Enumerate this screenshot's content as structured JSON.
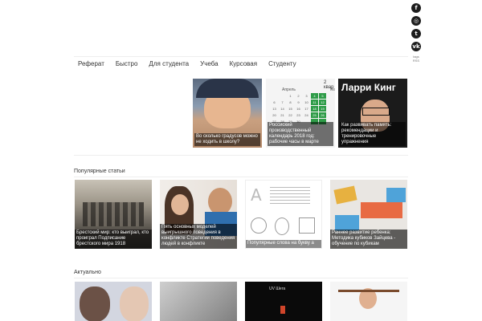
{
  "social": {
    "icons": [
      "facebook-icon",
      "instagram-icon",
      "twitter-icon",
      "vk-icon"
    ],
    "glyphs": [
      "f",
      "◎",
      "t",
      "vk"
    ],
    "small_text": "tags\nRSS"
  },
  "nav": {
    "items": [
      "Реферат",
      "Быстро",
      "Для студента",
      "Учеба",
      "Курсовая",
      "Студенту"
    ]
  },
  "featured": [
    {
      "caption": "Во сколько градусов можно не ходить в школу?"
    },
    {
      "caption": "Россиский производственный календарь 2018 год: рабочие часы в марте",
      "month": "Апрель",
      "corner_label": "2 квар",
      "corner_sub": "Ма"
    },
    {
      "caption": "Как развивать память: рекомендации и тренировочные упражнения",
      "title_text": "Ларри Кинг"
    }
  ],
  "popular": {
    "title": "Популярные статьи",
    "cards": [
      {
        "caption": "Брестский мир: кто выиграл, кто проиграл Подписание брестского мира 1918"
      },
      {
        "caption": "Пять основных моделей выигрышного поведения в конфликте Стратегии поведения людей в конфликте"
      },
      {
        "caption": "Популярные слова на букву а"
      },
      {
        "caption": "Раннее развитие ребенка: Методика кубиков Зайцева - обучение по кубикам"
      }
    ]
  },
  "actual": {
    "title": "Актуально",
    "card_text": "UV Шега"
  },
  "colors": {
    "accent_green": "#2e9c48",
    "text": "#333333"
  }
}
